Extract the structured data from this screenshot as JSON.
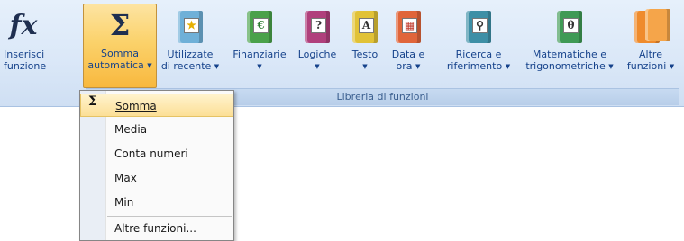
{
  "ribbon": {
    "group_label": "Libreria di funzioni",
    "buttons": [
      {
        "line1": "Inserisci",
        "line2": "funzione",
        "icon": "fx-icon",
        "glyph": "fx"
      },
      {
        "line1": "Somma",
        "line2": "automatica",
        "icon": "sigma-icon",
        "glyph": "Σ"
      },
      {
        "line1": "Utilizzate",
        "line2": "di recente",
        "icon": "book-star-icon",
        "glyph": "★",
        "color": "#6fb0d8"
      },
      {
        "line1": "Finanziarie",
        "line2": "",
        "icon": "book-money-icon",
        "glyph": "€",
        "color": "#4aa14a"
      },
      {
        "line1": "Logiche",
        "line2": "",
        "icon": "book-question-icon",
        "glyph": "?",
        "color": "#b0407c"
      },
      {
        "line1": "Testo",
        "line2": "",
        "icon": "book-text-icon",
        "glyph": "A",
        "color": "#e1c236"
      },
      {
        "line1": "Data e",
        "line2": "ora",
        "icon": "book-calendar-icon",
        "glyph": "▦",
        "color": "#e0653a"
      },
      {
        "line1": "Ricerca e",
        "line2": "riferimento",
        "icon": "book-lookup-icon",
        "glyph": "⚲",
        "color": "#3d8fa6"
      },
      {
        "line1": "Matematiche e",
        "line2": "trigonometriche",
        "icon": "book-theta-icon",
        "glyph": "θ",
        "color": "#3f9a55"
      },
      {
        "line1": "Altre",
        "line2": "funzioni",
        "icon": "books-more-icon",
        "glyph": "",
        "color": "#ef8b2c"
      }
    ]
  },
  "menu": {
    "items": [
      "Somma",
      "Media",
      "Conta numeri",
      "Max",
      "Min",
      "Altre funzioni..."
    ],
    "sigma": "Σ"
  }
}
